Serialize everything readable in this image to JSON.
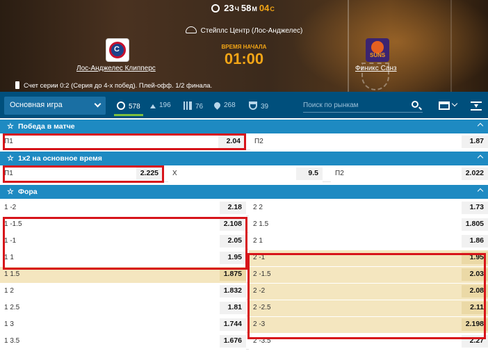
{
  "header": {
    "timer": {
      "hours": "23",
      "h_unit": "Ч",
      "minutes": "58",
      "m_unit": "М",
      "seconds": "04",
      "s_unit": "С"
    },
    "venue": "Стейплс Центр (Лос-Анджелес)",
    "start_label": "ВРЕМЯ НАЧАЛА",
    "start_time": "01:00",
    "team1": "Лос-Анджелес Клипперс",
    "team2": "Финикс Санз",
    "series_info": "Счет серии 0:2 (Серия до 4-х побед). Плей-офф. 1/2 финала."
  },
  "toolbar": {
    "select_value": "Основная игра",
    "filters": [
      {
        "icon": "target-icon",
        "count": "578"
      },
      {
        "icon": "updown-icon",
        "count": "196"
      },
      {
        "icon": "bars-icon",
        "count": "76"
      },
      {
        "icon": "fire-icon",
        "count": "268"
      },
      {
        "icon": "cup-icon",
        "count": "39"
      }
    ],
    "search_placeholder": "Поиск по рынкам"
  },
  "sections": {
    "win": {
      "title": "Победа в матче",
      "p1_label": "П1",
      "p1_odd": "2.04",
      "p2_label": "П2",
      "p2_odd": "1.87"
    },
    "x12": {
      "title": "1х2 на основное время",
      "p1_label": "П1",
      "p1_odd": "2.225",
      "x_label": "Х",
      "x_odd": "9.5",
      "p2_label": "П2",
      "p2_odd": "2.022"
    },
    "handicap": {
      "title": "Фора",
      "rows": [
        {
          "l": "1 -2",
          "lo": "2.18",
          "r": "2 2",
          "ro": "1.73"
        },
        {
          "l": "1 -1.5",
          "lo": "2.108",
          "r": "2 1.5",
          "ro": "1.805"
        },
        {
          "l": "1 -1",
          "lo": "2.05",
          "r": "2 1",
          "ro": "1.86"
        },
        {
          "l": "1 1",
          "lo": "1.95",
          "r": "2 -1",
          "ro": "1.95"
        },
        {
          "l": "1 1.5",
          "lo": "1.875",
          "r": "2 -1.5",
          "ro": "2.03"
        },
        {
          "l": "1 2",
          "lo": "1.832",
          "r": "2 -2",
          "ro": "2.08"
        },
        {
          "l": "1 2.5",
          "lo": "1.81",
          "r": "2 -2.5",
          "ro": "2.11"
        },
        {
          "l": "1 3",
          "lo": "1.744",
          "r": "2 -3",
          "ro": "2.198"
        },
        {
          "l": "1 3.5",
          "lo": "1.676",
          "r": "2 -3.5",
          "ro": "2.27"
        }
      ]
    }
  },
  "colors": {
    "accent": "#1e8ac2",
    "toolbar": "#004f7c",
    "highlight": "#f4e6bf",
    "annotation": "#d7141a",
    "time": "#f2a516"
  }
}
